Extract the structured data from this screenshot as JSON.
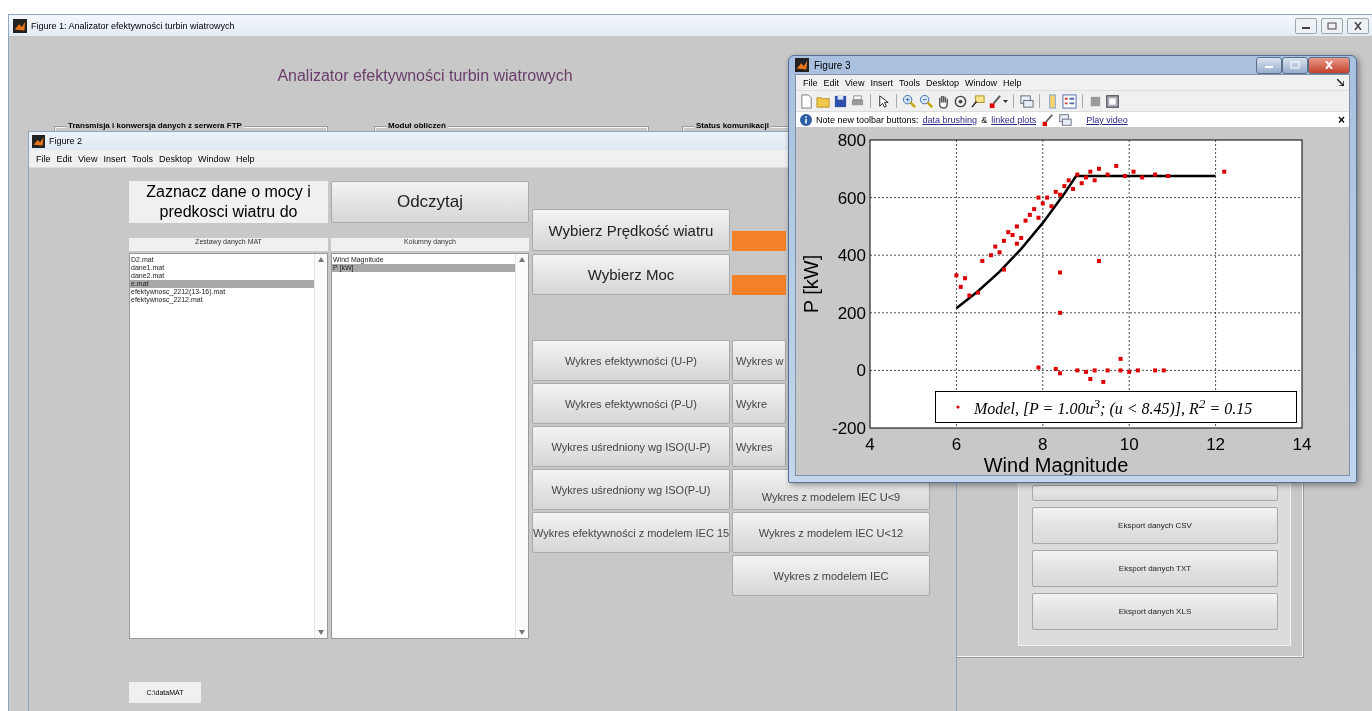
{
  "figure1": {
    "title": "Figure 1: Analizator efektywności turbin wiatrowych",
    "heading": "Analizator efektywności turbin wiatrowych",
    "panels": [
      {
        "title": "Transmisja i konwersja danych z serwera FTP"
      },
      {
        "title": "Moduł obliczeń"
      },
      {
        "title": "Status komunikacji"
      }
    ],
    "export_buttons": [
      "Eksport danych CSV",
      "Eksport danych TXT",
      "Eksport danych XLS"
    ]
  },
  "figure2": {
    "title": "Figure 2",
    "menu": [
      "File",
      "Edit",
      "View",
      "Insert",
      "Tools",
      "Desktop",
      "Window",
      "Help"
    ],
    "prompt": "Zaznacz dane o mocy i predkosci wiatru do",
    "read_button": "Odczytaj",
    "datasets": {
      "heading": "Zestawy danych MAT",
      "items": [
        {
          "label": "D2.mat",
          "selected": false
        },
        {
          "label": "dane1.mat",
          "selected": false
        },
        {
          "label": "dane2.mat",
          "selected": false
        },
        {
          "label": "e.mat",
          "selected": true
        },
        {
          "label": "efektywnosc_2212(13-16).mat",
          "selected": false
        },
        {
          "label": "efektywnosc_2212.mat",
          "selected": false
        }
      ]
    },
    "columns": {
      "heading": "Kolumny danych",
      "items": [
        {
          "label": "Wind Magnitude",
          "selected": false
        },
        {
          "label": "P [kW]",
          "selected": true
        }
      ]
    },
    "select_buttons": [
      "Wybierz Prędkość wiatru",
      "Wybierz Moc"
    ],
    "plot_buttons_left": [
      "Wykres efektywności (U-P)",
      "Wykres efektywności (P-U)",
      "Wykres uśredniony wg ISO(U-P)",
      "Wykres uśredniony wg ISO(P-U)",
      "Wykres efektywności z modelem IEC 15"
    ],
    "plot_buttons_right": [
      "Wykres w",
      "Wykre",
      "Wykres",
      "Wykres z modelem IEC U<9",
      "Wykres z modelem IEC U<12",
      "Wykres z modelem IEC"
    ],
    "path": "C:\\dataMAT"
  },
  "figure3": {
    "title": "Figure 3",
    "menu": [
      "File",
      "Edit",
      "View",
      "Insert",
      "Tools",
      "Desktop",
      "Window",
      "Help"
    ],
    "notice": {
      "label": "Note new toolbar buttons:",
      "brushing_link": "data brushing",
      "amp": "&",
      "linked_link": "linked plots",
      "video_link": "Play video",
      "close": "×"
    },
    "chart_data": {
      "type": "scatter",
      "xlabel": "Wind Magnitude",
      "ylabel": "P [kW]",
      "xlim": [
        4,
        14
      ],
      "ylim": [
        -200,
        800
      ],
      "xticks": [
        4,
        6,
        8,
        10,
        12,
        14
      ],
      "yticks": [
        -200,
        0,
        200,
        400,
        600,
        800
      ],
      "grid": true,
      "series": [
        {
          "type": "scatter",
          "name": "Model, [P = 1.00u$^{3}$; (u < 8.45)], R$^{2}$ = 0.15",
          "color": "#dd0000",
          "x": [
            6,
            6.1,
            6.2,
            6.3,
            6.5,
            6.6,
            6.8,
            6.9,
            7,
            7.1,
            7.2,
            7.3,
            7.4,
            7.5,
            7.6,
            7.7,
            7.8,
            7.9,
            8,
            8.1,
            8.2,
            8.3,
            8.4,
            8.5,
            8.6,
            8.7,
            8.8,
            8.9,
            9,
            9.1,
            9.2,
            9.3,
            9.5,
            9.7,
            9.9,
            10.1,
            10.3,
            10.6,
            10.9,
            12.2,
            7.4,
            7.9,
            8.4,
            9.3,
            8.4,
            7.1,
            7.9,
            8.3,
            8.4,
            8.8,
            9,
            9.2,
            9.4,
            9.5,
            9.8,
            9.8,
            10,
            10.2,
            10.6,
            10.8,
            9.1
          ],
          "values": [
            330,
            290,
            320,
            260,
            270,
            380,
            400,
            430,
            410,
            450,
            480,
            470,
            500,
            460,
            520,
            540,
            560,
            530,
            580,
            600,
            570,
            620,
            610,
            640,
            660,
            630,
            680,
            650,
            670,
            690,
            660,
            700,
            680,
            710,
            675,
            690,
            670,
            680,
            675,
            690,
            440,
            600,
            340,
            380,
            200,
            350,
            10,
            5,
            -10,
            0,
            -5,
            0,
            -40,
            0,
            40,
            0,
            -5,
            0,
            0,
            0,
            -30
          ]
        },
        {
          "type": "line",
          "color": "#000000",
          "x": [
            6,
            6.5,
            7,
            7.5,
            8,
            8.5,
            8.77,
            12
          ],
          "values": [
            216,
            275,
            343,
            422,
            512,
            614,
            675,
            675
          ]
        }
      ]
    }
  }
}
